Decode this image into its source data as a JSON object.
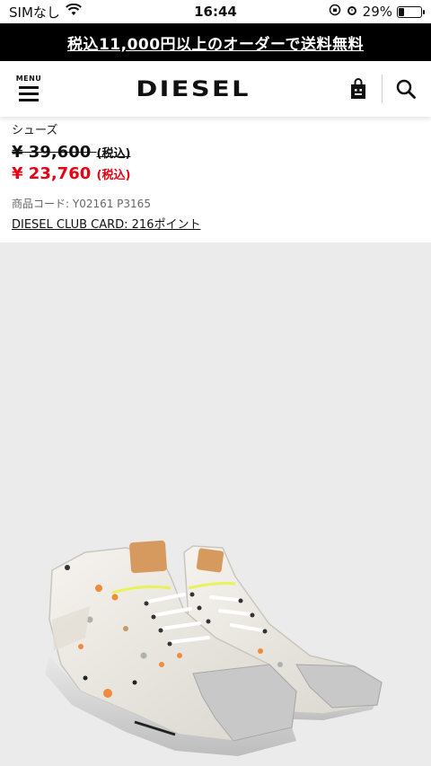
{
  "status_bar": {
    "carrier": "SIMなし",
    "time": "16:44",
    "battery": "29%",
    "battery_level": 0.29
  },
  "promo": {
    "text": "税込11,000円以上のオーダーで送料無料"
  },
  "header": {
    "menu_label": "MENU",
    "logo": "DIESEL",
    "bag_icon": "shopping-bag-icon",
    "search_icon": "search-icon"
  },
  "product": {
    "category": "シューズ",
    "original_price": "¥ 39,600",
    "original_tax": "(税込)",
    "sale_price": "¥ 23,760",
    "sale_tax": "(税込)",
    "code": "商品コード: Y02161 P3165",
    "club_card": "DIESEL CLUB CARD: 216ポイント"
  },
  "colors": {
    "sale": "#e60012",
    "banner": "#000000",
    "image_bg": "#ebebeb"
  }
}
